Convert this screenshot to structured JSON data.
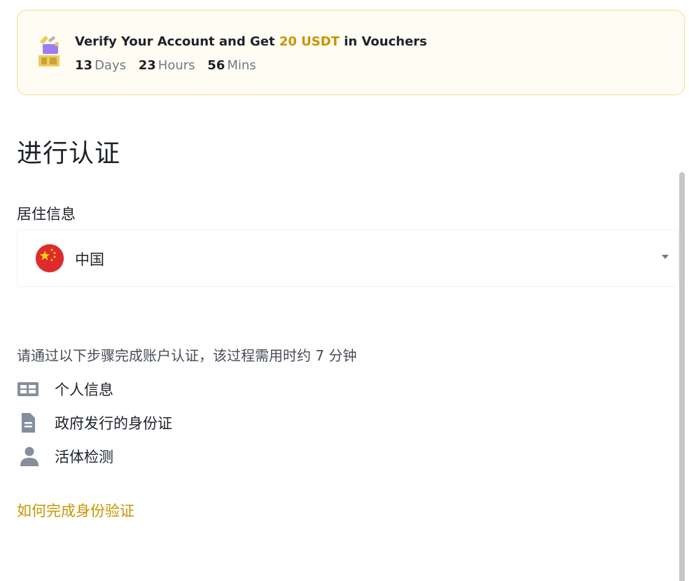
{
  "promo": {
    "title_prefix": "Verify Your Account and Get ",
    "title_accent": "20 USDT",
    "title_suffix": " in Vouchers",
    "countdown": {
      "days": "13",
      "days_unit": "Days",
      "hours": "23",
      "hours_unit": "Hours",
      "mins": "56",
      "mins_unit": "Mins"
    },
    "icon": "gift-voucher-icon"
  },
  "page": {
    "title": "进行认证"
  },
  "residence": {
    "label": "居住信息",
    "selected_country": "中国",
    "flag_icon": "china-flag-icon"
  },
  "steps": {
    "intro": "请通过以下步骤完成账户认证，该过程需用时约 7 分钟",
    "items": [
      {
        "label": "个人信息",
        "icon": "id-card-icon"
      },
      {
        "label": "政府发行的身份证",
        "icon": "document-icon"
      },
      {
        "label": "活体检测",
        "icon": "person-icon"
      }
    ]
  },
  "help": {
    "link_label": "如何完成身份验证"
  },
  "colors": {
    "accent": "#c99400",
    "promo_border": "#f5dc86",
    "promo_bg": "#fffcf3",
    "icon_gray": "#848e9c",
    "flag_red": "#de2c2c"
  }
}
